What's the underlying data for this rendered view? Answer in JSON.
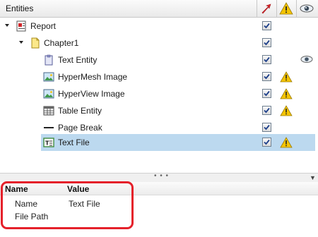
{
  "entities_panel": {
    "title": "Entities",
    "columns": [
      "visible-check",
      "warning",
      "show"
    ],
    "rows": [
      {
        "label": "Report",
        "icon": "report-icon",
        "checked": true,
        "warning": false,
        "eye": false,
        "selected": false
      },
      {
        "label": "Chapter1",
        "icon": "chapter-icon",
        "checked": true,
        "warning": false,
        "eye": false,
        "selected": false
      },
      {
        "label": "Text Entity",
        "icon": "text-entity-icon",
        "checked": true,
        "warning": false,
        "eye": true,
        "selected": false
      },
      {
        "label": "HyperMesh Image",
        "icon": "image-icon",
        "checked": true,
        "warning": true,
        "eye": false,
        "selected": false
      },
      {
        "label": "HyperView Image",
        "icon": "image-icon",
        "checked": true,
        "warning": true,
        "eye": false,
        "selected": false
      },
      {
        "label": "Table Entity",
        "icon": "table-icon",
        "checked": true,
        "warning": true,
        "eye": false,
        "selected": false
      },
      {
        "label": "Page Break",
        "icon": "page-break-icon",
        "checked": true,
        "warning": false,
        "eye": false,
        "selected": false
      },
      {
        "label": "Text File",
        "icon": "text-file-icon",
        "checked": true,
        "warning": true,
        "eye": false,
        "selected": true
      }
    ]
  },
  "splitter": {
    "dots": "• • •"
  },
  "properties": {
    "col_name": "Name",
    "col_value": "Value",
    "rows": [
      {
        "name": "Name",
        "value": "Text File"
      },
      {
        "name": "File Path",
        "value": ""
      }
    ]
  },
  "colors": {
    "selection": "#bcd9ef",
    "highlight": "#e5202a",
    "warning": "#f5c400"
  }
}
